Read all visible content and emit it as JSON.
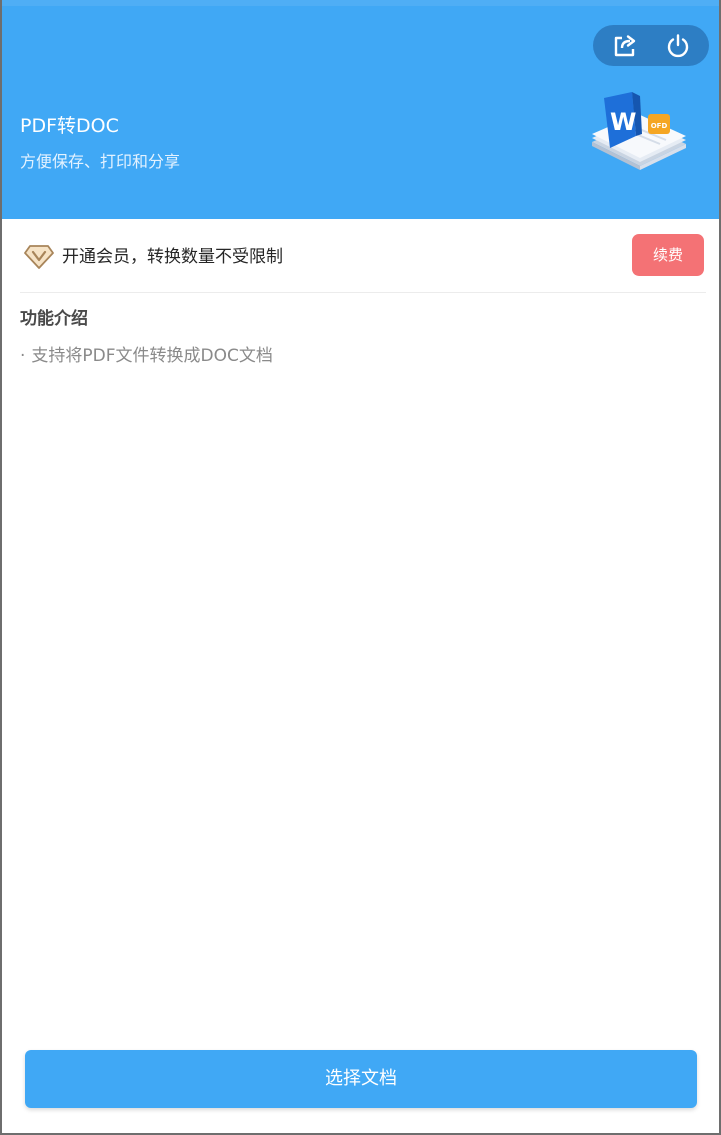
{
  "header": {
    "title": "PDF转DOC",
    "subtitle": "方便保存、打印和分享",
    "bg_color": "#40a8f5",
    "actions": [
      {
        "icon": "share-icon"
      },
      {
        "icon": "power-icon"
      }
    ],
    "illustration": {
      "word_letter": "W",
      "badge_text": "OFD"
    }
  },
  "membership": {
    "icon": "vip-diamond-icon",
    "text": "开通会员，转换数量不受限制",
    "renew_label": "续费",
    "renew_color": "#f47275"
  },
  "features": {
    "title": "功能介绍",
    "items": [
      "支持将PDF文件转换成DOC文档"
    ],
    "bullet": "·"
  },
  "footer": {
    "select_label": "选择文档"
  }
}
